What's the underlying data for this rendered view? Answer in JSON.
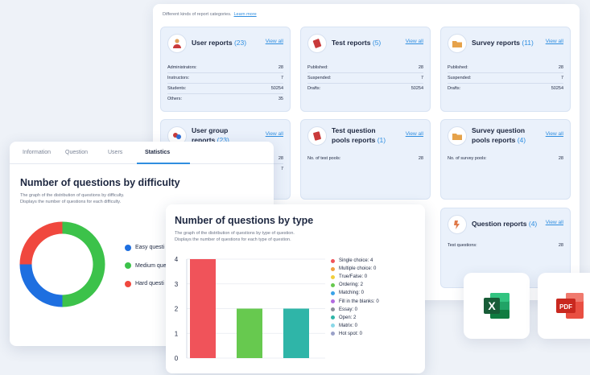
{
  "reports": {
    "hint": "Different kinds of report categories.",
    "learn_more": "Learn more",
    "view_all": "View all",
    "user": {
      "title": "User reports",
      "count": "(23)",
      "rows": [
        {
          "label": "Administrators:",
          "value": "28"
        },
        {
          "label": "Instructors:",
          "value": "7"
        },
        {
          "label": "Students:",
          "value": "50254"
        },
        {
          "label": "Others:",
          "value": "35"
        }
      ]
    },
    "test": {
      "title": "Test reports",
      "count": "(5)",
      "rows": [
        {
          "label": "Published:",
          "value": "28"
        },
        {
          "label": "Suspended:",
          "value": "7"
        },
        {
          "label": "Drafts:",
          "value": "50254"
        }
      ]
    },
    "survey": {
      "title": "Survey reports",
      "count": "(11)",
      "rows": [
        {
          "label": "Published:",
          "value": "28"
        },
        {
          "label": "Suspended:",
          "value": "7"
        },
        {
          "label": "Drafts:",
          "value": "50254"
        }
      ]
    },
    "usergroup": {
      "title_line1": "User group",
      "title_line2": "reports",
      "count": "(23)",
      "rows": [
        {
          "label": "",
          "value": "28"
        },
        {
          "label": "",
          "value": "7"
        }
      ]
    },
    "testpool": {
      "title_line1": "Test question",
      "title_line2": "pools reports",
      "count": "(1)",
      "rows": [
        {
          "label": "No. of test pools:",
          "value": "28"
        }
      ]
    },
    "surveypool": {
      "title_line1": "Survey question",
      "title_line2": "pools reports",
      "count": "(4)",
      "rows": [
        {
          "label": "No. of survey pools:",
          "value": "28"
        }
      ]
    },
    "question": {
      "title": "Question reports",
      "count": "(4)",
      "rows": [
        {
          "label": "Test questions:",
          "value": "28"
        }
      ]
    }
  },
  "tabs": [
    "Information",
    "Question",
    "Users",
    "Statistics"
  ],
  "difficulty": {
    "title": "Number of questions by difficulty",
    "desc_line1": "The graph of the distribution of questions by difficulty.",
    "desc_line2": "Displays the number of questions for each difficulty.",
    "legend": [
      {
        "label": "Easy questi",
        "color": "#1e6fe0"
      },
      {
        "label": "Medium que",
        "color": "#3cc24a"
      },
      {
        "label": "Hard questi",
        "color": "#f0483e"
      }
    ]
  },
  "type_chart": {
    "title": "Number of questions by type",
    "desc_line1": "The graph of the distribution of questions by type of question.",
    "desc_line2": "Displays the number of questions for each type of question.",
    "legend": [
      {
        "label": "Single choice: 4",
        "color": "#f0535a"
      },
      {
        "label": "Multiple choice: 0",
        "color": "#f0a040"
      },
      {
        "label": "True/False: 0",
        "color": "#f2cf3c"
      },
      {
        "label": "Ordering: 2",
        "color": "#67c94f"
      },
      {
        "label": "Matching: 0",
        "color": "#3aa3e8"
      },
      {
        "label": "Fill in the blanks: 0",
        "color": "#b36be0"
      },
      {
        "label": "Essay: 0",
        "color": "#8a8f99"
      },
      {
        "label": "Open: 2",
        "color": "#2fb5a8"
      },
      {
        "label": "Matrix: 0",
        "color": "#8ad8e8"
      },
      {
        "label": "Hot spot: 0",
        "color": "#9aa0c8"
      }
    ]
  },
  "chart_data": [
    {
      "type": "pie",
      "title": "Number of questions by difficulty",
      "categories": [
        "Easy questions",
        "Medium questions",
        "Hard questions"
      ],
      "values": [
        1,
        2,
        1
      ],
      "colors": [
        "#1e6fe0",
        "#3cc24a",
        "#f0483e"
      ]
    },
    {
      "type": "bar",
      "title": "Number of questions by type",
      "categories": [
        "Single choice",
        "Ordering",
        "Open"
      ],
      "values": [
        4,
        2,
        2
      ],
      "colors": [
        "#f0535a",
        "#67c94f",
        "#2fb5a8"
      ],
      "ylim": [
        0,
        4
      ],
      "yticks": [
        0,
        1,
        2,
        3,
        4
      ],
      "grid": true
    }
  ],
  "exports": [
    {
      "name": "excel",
      "label": "X",
      "color": "#1f7a45"
    },
    {
      "name": "pdf",
      "label": "PDF",
      "color": "#d8322a"
    }
  ]
}
